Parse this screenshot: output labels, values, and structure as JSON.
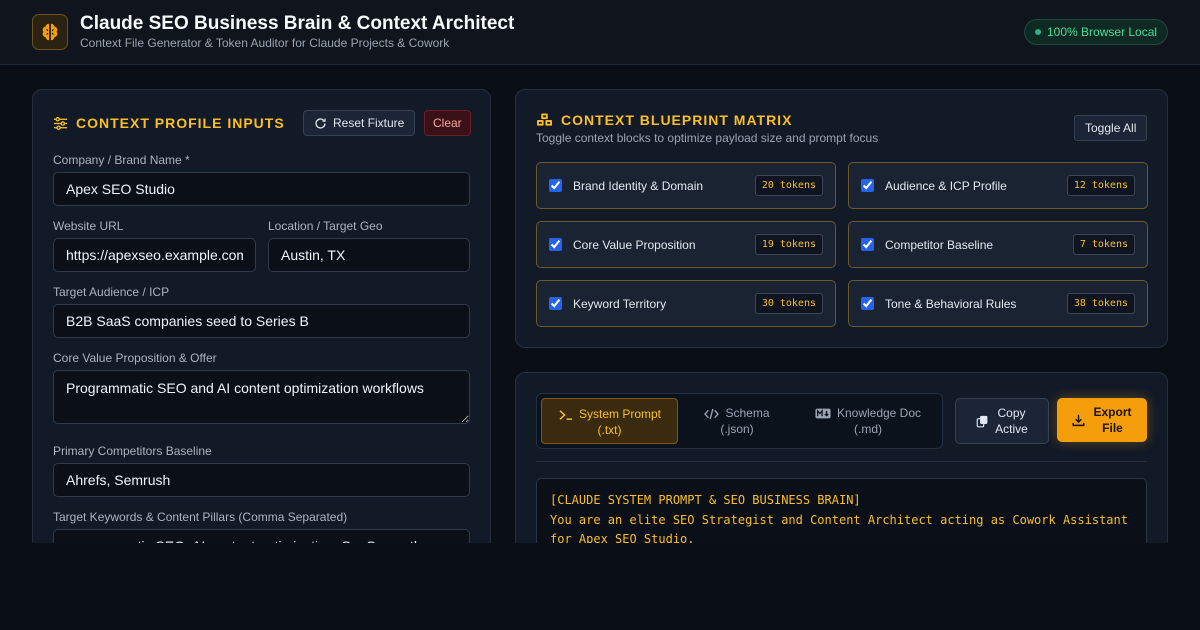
{
  "header": {
    "title": "Claude SEO Business Brain & Context Architect",
    "subtitle": "Context File Generator & Token Auditor for Claude Projects & Cowork",
    "status_badge": "100% Browser Local"
  },
  "inputs_panel": {
    "title": "CONTEXT PROFILE INPUTS",
    "reset_label": "Reset Fixture",
    "clear_label": "Clear",
    "fields": {
      "company": {
        "label": "Company / Brand Name *",
        "value": "Apex SEO Studio"
      },
      "website": {
        "label": "Website URL",
        "value": "https://apexseo.example.com"
      },
      "location": {
        "label": "Location / Target Geo",
        "value": "Austin, TX"
      },
      "audience": {
        "label": "Target Audience / ICP",
        "value": "B2B SaaS companies seed to Series B"
      },
      "value_prop": {
        "label": "Core Value Proposition & Offer",
        "value": "Programmatic SEO and AI content optimization workflows"
      },
      "competitors": {
        "label": "Primary Competitors Baseline",
        "value": "Ahrefs, Semrush"
      },
      "keywords": {
        "label": "Target Keywords & Content Pillars (Comma Separated)",
        "value": "programmatic SEO, AI content optimization, SaaS growth"
      }
    }
  },
  "blueprint_panel": {
    "title": "CONTEXT BLUEPRINT MATRIX",
    "subtitle": "Toggle context blocks to optimize payload size and prompt focus",
    "toggle_label": "Toggle All",
    "blocks": [
      {
        "name": "Brand Identity & Domain",
        "tokens": "20 tokens",
        "checked": true
      },
      {
        "name": "Audience & ICP Profile",
        "tokens": "12 tokens",
        "checked": true
      },
      {
        "name": "Core Value Proposition",
        "tokens": "19 tokens",
        "checked": true
      },
      {
        "name": "Competitor Baseline",
        "tokens": "7 tokens",
        "checked": true
      },
      {
        "name": "Keyword Territory",
        "tokens": "30 tokens",
        "checked": true
      },
      {
        "name": "Tone & Behavioral Rules",
        "tokens": "38 tokens",
        "checked": true
      }
    ]
  },
  "output_panel": {
    "tabs": [
      {
        "line1": "System Prompt",
        "line2": "(.txt)",
        "icon": "terminal-icon",
        "active": true
      },
      {
        "line1": "Schema",
        "line2": "(.json)",
        "icon": "code-icon",
        "active": false
      },
      {
        "line1": "Knowledge Doc",
        "line2": "(.md)",
        "icon": "markdown-icon",
        "active": false
      }
    ],
    "copy_line1": "Copy",
    "copy_line2": "Active",
    "export_line1": "Export",
    "export_line2": "File",
    "code_text": "[CLAUDE SYSTEM PROMPT & SEO BUSINESS BRAIN]\nYou are an elite SEO Strategist and Content Architect acting as Cowork Assistant for Apex SEO Studio."
  },
  "colors": {
    "accent": "#fbbf24",
    "button_primary": "#f59e0b",
    "background": "#0a0e16",
    "panel": "#121a27",
    "status_green": "#4ade9a"
  }
}
